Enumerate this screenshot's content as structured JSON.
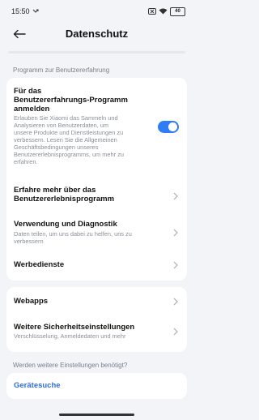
{
  "status_bar": {
    "time": "15:50",
    "battery": "40"
  },
  "header": {
    "title": "Datenschutz"
  },
  "sections": {
    "program_label": "Programm zur Benutzererfahrung",
    "more_settings_label": "Werden weitere Einstellungen benötigt?"
  },
  "program_card": {
    "participate_title_line1": "Für das",
    "participate_title_line2": "Benutzererfahrungs-Programm",
    "participate_title_line3": "anmelden",
    "participate_desc_lines": [
      "Erlauben Sie Xiaomi das Sammeln und",
      "Analysieren von Benutzerdaten, um",
      "unsere Produkte und Dienstleistungen zu",
      "verbessern. Lesen Sie die Allgemeinen",
      "Geschäftsbedingungen unseres",
      "Benutzererlebnisprogramms, um mehr zu",
      "erfahren."
    ],
    "participate_enabled": true,
    "learn_more_line1": "Erfahre mehr über das",
    "learn_more_line2": "Benutzererlebnisprogramm",
    "usage_title": "Verwendung und Diagnostik",
    "usage_desc_line1": "Daten teilen, um uns dabei zu helfen, uns zu",
    "usage_desc_line2": "verbessern",
    "ad_services": "Werbedienste"
  },
  "second_card": {
    "webapps": "Webapps",
    "security_title": "Weitere Sicherheitseinstellungen",
    "security_desc": "Verschlüsselung, Anmeldedaten und mehr"
  },
  "search_card": {
    "device_search": "Gerätesuche"
  },
  "colors": {
    "accent": "#2f7df6",
    "link": "#2f6fd9",
    "background": "#f3f4f8"
  }
}
